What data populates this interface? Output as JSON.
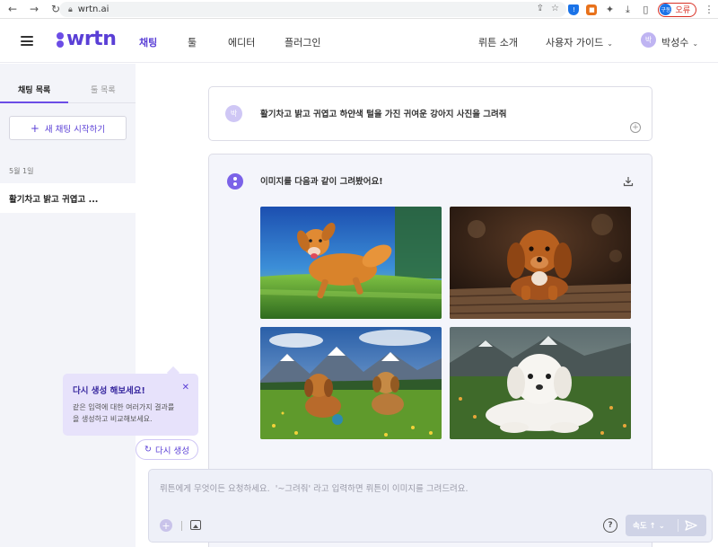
{
  "browser": {
    "url": "wrtn.ai",
    "profile_initial": "구동",
    "profile_status": "오류"
  },
  "header": {
    "logo": "wrtn",
    "nav": [
      "채팅",
      "툴",
      "에디터",
      "플러그인"
    ],
    "about": "뤼튼 소개",
    "guide": "사용자 가이드",
    "user_initial": "박",
    "user_name": "박성수"
  },
  "sidebar": {
    "tab_chat": "채팅 목록",
    "tab_tool": "툴 목록",
    "new_chat": "새 채팅 시작하기",
    "date_label": "5월 1일",
    "chat_items": [
      "활기차고 밝고 귀엽고 ..."
    ]
  },
  "tooltip": {
    "title": "다시 생성 해보세요!",
    "body_line1": "같은 입력에 대한 여러가지 결과를",
    "body_line2": "을 생성하고 비교해보세요."
  },
  "regenerate": "다시 생성",
  "conversation": {
    "user_initial": "박",
    "prompt": "활기차고 밝고 귀엽고 하얀색 털을 가진 귀여운 강아지 사진을 그려줘",
    "response": "이미지를 다음과 같이 그려봤어요!"
  },
  "input": {
    "placeholder": "뤼튼에게 무엇이든 요청하세요.  '~그려줘' 라고 입력하면 뤼튼이 이미지를 그려드려요.",
    "value": "",
    "speed_label": "속도"
  },
  "colors": {
    "brand": "#6c4de6",
    "sidebar_bg": "#f3f4f9",
    "tooltip_bg": "#e7e2fb"
  }
}
